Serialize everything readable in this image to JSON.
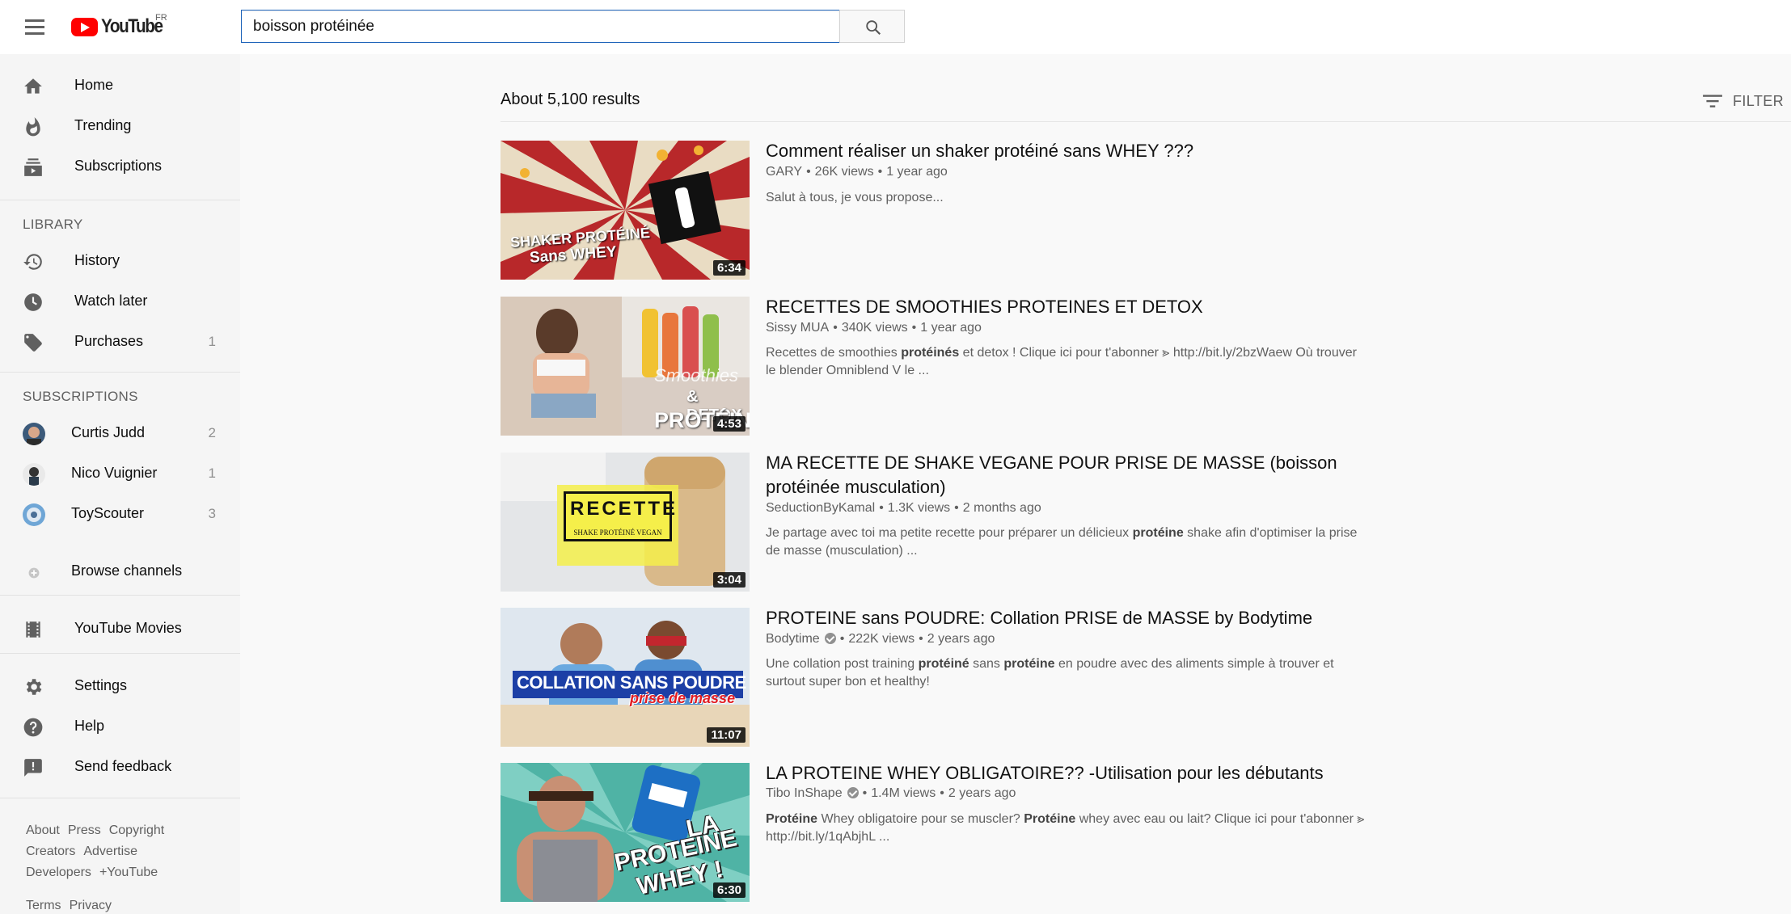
{
  "masthead": {
    "logo_text": "YouTube",
    "country_code": "FR",
    "search_value": "boisson protéinée"
  },
  "sidebar": {
    "main_items": [
      {
        "label": "Home",
        "icon": "home-icon"
      },
      {
        "label": "Trending",
        "icon": "fire-icon"
      },
      {
        "label": "Subscriptions",
        "icon": "subscriptions-icon"
      }
    ],
    "library_heading": "LIBRARY",
    "library_items": [
      {
        "label": "History",
        "icon": "history-icon",
        "count": ""
      },
      {
        "label": "Watch later",
        "icon": "clock-icon",
        "count": ""
      },
      {
        "label": "Purchases",
        "icon": "tag-icon",
        "count": "1"
      }
    ],
    "subscriptions_heading": "SUBSCRIPTIONS",
    "subscriptions": [
      {
        "label": "Curtis Judd",
        "count": "2"
      },
      {
        "label": "Nico Vuignier",
        "count": "1"
      },
      {
        "label": "ToyScouter",
        "count": "3"
      }
    ],
    "browse_channels": "Browse channels",
    "youtube_movies": "YouTube Movies",
    "settings": "Settings",
    "help": "Help",
    "send_feedback": "Send feedback",
    "footer_row1": [
      "About",
      "Press",
      "Copyright"
    ],
    "footer_row2": [
      "Creators",
      "Advertise"
    ],
    "footer_row3": [
      "Developers",
      "+YouTube"
    ],
    "footer_row4": [
      "Terms",
      "Privacy"
    ]
  },
  "results": {
    "count_text": "About 5,100 results",
    "filter_label": "FILTER",
    "videos": [
      {
        "title": "Comment réaliser un shaker protéiné sans WHEY ???",
        "channel": "GARY",
        "verified": false,
        "views": "26K views",
        "age": "1 year ago",
        "duration": "6:34",
        "thumb_text1": "SHAKER PROTÉINÉ",
        "thumb_text2": "Sans WHEY",
        "desc1": "Salut à tous, je vous propose...",
        "desc2": ""
      },
      {
        "title": "RECETTES DE SMOOTHIES PROTEINES ET DETOX",
        "channel": "Sissy MUA",
        "verified": false,
        "views": "340K views",
        "age": "1 year ago",
        "duration": "4:53",
        "thumb_text1": "Smoothies",
        "thumb_text2": "& DETOX",
        "thumb_text3": "PROTÉINÉS",
        "desc_a": "Recettes de smoothies ",
        "desc_b": "protéinés",
        "desc_c": " et detox ! Clique ici pour t'abonner ⪢ http://bit.ly/2bzWaew Où trouver",
        "desc2": "le blender Omniblend V le ..."
      },
      {
        "title_line1": "MA RECETTE DE SHAKE VEGANE POUR PRISE DE MASSE (boisson",
        "title_line2": "protéinée musculation)",
        "channel": "SeductionByKamal",
        "verified": false,
        "views": "1.3K views",
        "age": "2 months ago",
        "duration": "3:04",
        "thumb_text1": "RECETTE",
        "thumb_text2": "SHAKE PROTÉINÉ VEGAN",
        "desc_a": "Je partage avec toi ma petite recette pour préparer un délicieux ",
        "desc_b": "protéine",
        "desc_c": " shake afin d'optimiser la prise",
        "desc2": "de masse (musculation) ..."
      },
      {
        "title": "PROTEINE sans POUDRE: Collation PRISE de MASSE by Bodytime",
        "channel": "Bodytime",
        "verified": true,
        "views": "222K views",
        "age": "2 years ago",
        "duration": "11:07",
        "thumb_text1": "COLLATION SANS POUDRE",
        "thumb_text2": "prise de masse",
        "desc_a": "Une collation post training ",
        "desc_b": "protéiné",
        "desc_c": " sans ",
        "desc_d": "protéine",
        "desc_e": " en poudre avec des aliments simple à trouver et",
        "desc2": "surtout super bon et healthy!"
      },
      {
        "title": "LA PROTEINE WHEY OBLIGATOIRE?? -Utilisation pour les débutants",
        "channel": "Tibo InShape",
        "verified": true,
        "views": "1.4M views",
        "age": "2 years ago",
        "duration": "6:30",
        "thumb_text1": "LA",
        "thumb_text2": "PROTEINE",
        "thumb_text3": "WHEY !",
        "desc_a": "Protéine",
        "desc_b": " Whey obligatoire pour se muscler? ",
        "desc_c": "Protéine",
        "desc_d": " whey avec eau ou lait? Clique ici pour t'abonner ⪢",
        "desc2": "http://bit.ly/1qAbjhL ..."
      }
    ]
  }
}
